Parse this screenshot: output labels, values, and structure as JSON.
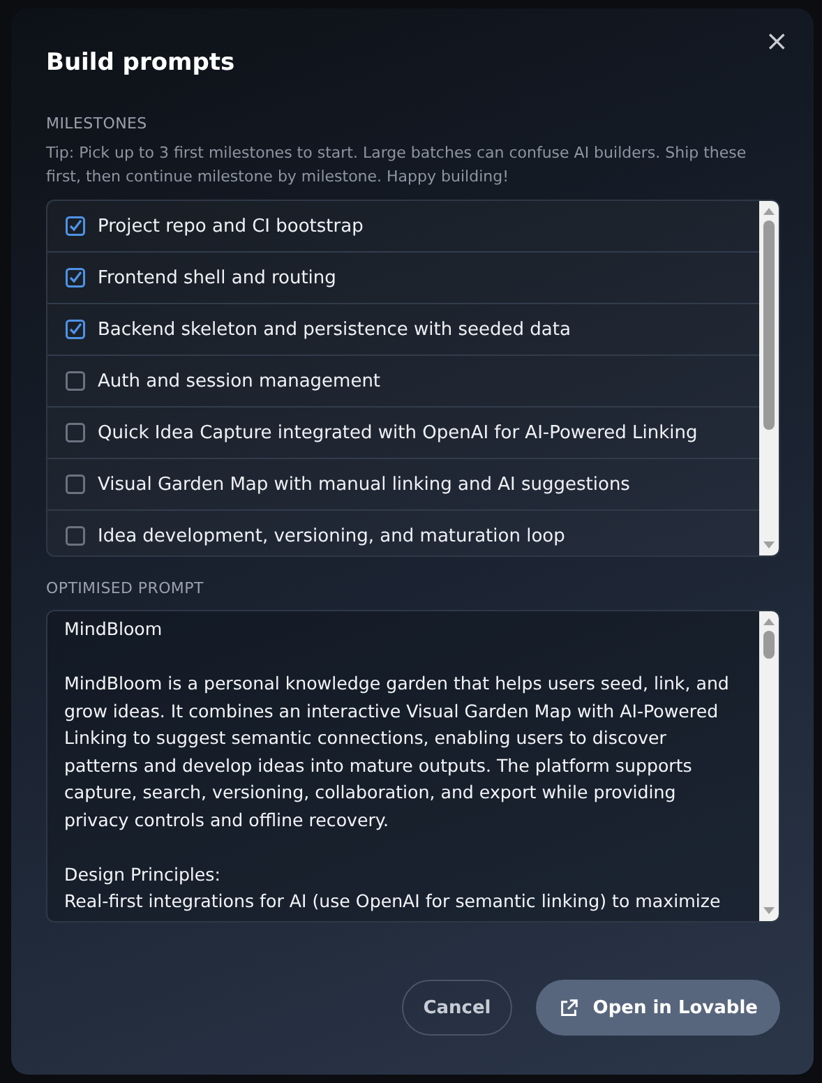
{
  "dialog": {
    "title": "Build prompts",
    "close": "×"
  },
  "milestones": {
    "label": "MILESTONES",
    "tip": "Tip: Pick up to 3 first milestones to start. Large batches can confuse AI builders. Ship these first, then continue milestone by milestone. Happy building!",
    "items": [
      {
        "label": "Project repo and CI bootstrap",
        "checked": true
      },
      {
        "label": "Frontend shell and routing",
        "checked": true
      },
      {
        "label": "Backend skeleton and persistence with seeded data",
        "checked": true
      },
      {
        "label": "Auth and session management",
        "checked": false
      },
      {
        "label": "Quick Idea Capture integrated with OpenAI for AI-Powered Linking",
        "checked": false
      },
      {
        "label": "Visual Garden Map with manual linking and AI suggestions",
        "checked": false
      },
      {
        "label": "Idea development, versioning, and maturation loop",
        "checked": false
      }
    ]
  },
  "prompt": {
    "label": "OPTIMISED PROMPT",
    "value": "MindBloom\n\nMindBloom is a personal knowledge garden that helps users seed, link, and grow ideas. It combines an interactive Visual Garden Map with AI-Powered Linking to suggest semantic connections, enabling users to discover patterns and develop ideas into mature outputs. The platform supports capture, search, versioning, collaboration, and export while providing privacy controls and offline recovery.\n\nDesign Principles:\nReal-first integrations for AI (use OpenAI for semantic linking) to maximize"
  },
  "buttons": [
    {
      "label": "Cancel",
      "kind": "secondary"
    },
    {
      "label": "Open in Lovable",
      "kind": "primary"
    }
  ]
}
